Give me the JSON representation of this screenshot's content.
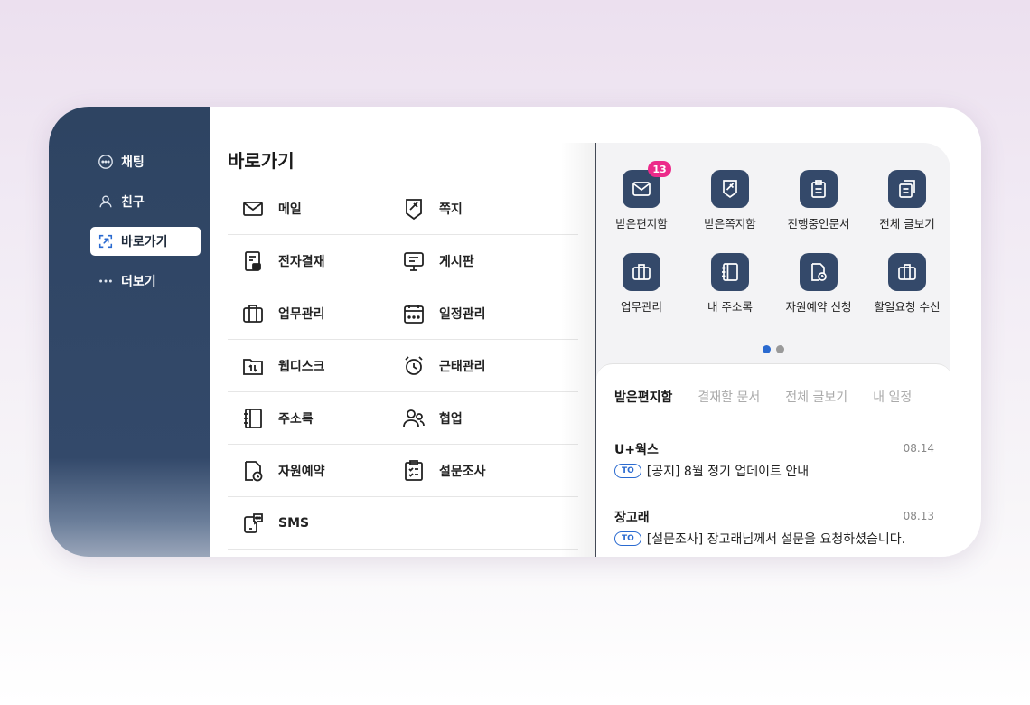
{
  "sidebar": {
    "items": [
      {
        "label": "채팅",
        "icon": "chat-icon"
      },
      {
        "label": "친구",
        "icon": "person-icon"
      },
      {
        "label": "바로가기",
        "icon": "shortcut-icon",
        "active": true
      },
      {
        "label": "더보기",
        "icon": "more-icon"
      }
    ]
  },
  "shortcuts": {
    "title": "바로가기",
    "items": [
      {
        "label": "메일",
        "icon": "mail-icon"
      },
      {
        "label": "쪽지",
        "icon": "note-icon"
      },
      {
        "label": "전자결재",
        "icon": "approval-icon"
      },
      {
        "label": "게시판",
        "icon": "board-icon"
      },
      {
        "label": "업무관리",
        "icon": "briefcase-icon"
      },
      {
        "label": "일정관리",
        "icon": "calendar-icon"
      },
      {
        "label": "웹디스크",
        "icon": "webdisk-icon"
      },
      {
        "label": "근태관리",
        "icon": "alarm-icon"
      },
      {
        "label": "주소록",
        "icon": "addressbook-icon"
      },
      {
        "label": "협업",
        "icon": "collab-icon"
      },
      {
        "label": "자원예약",
        "icon": "reservation-icon"
      },
      {
        "label": "설문조사",
        "icon": "survey-icon"
      },
      {
        "label": "SMS",
        "icon": "sms-icon"
      }
    ]
  },
  "widget": {
    "apps": [
      {
        "label": "받은편지함",
        "icon": "mail-icon",
        "badge": "13"
      },
      {
        "label": "받은쪽지함",
        "icon": "note-icon"
      },
      {
        "label": "진행중인문서",
        "icon": "clipboard-icon"
      },
      {
        "label": "전체 글보기",
        "icon": "documents-icon"
      },
      {
        "label": "업무관리",
        "icon": "briefcase-icon"
      },
      {
        "label": "내 주소록",
        "icon": "addressbook-icon"
      },
      {
        "label": "자원예약 신청",
        "icon": "reservation-icon"
      },
      {
        "label": "할일요청 수신",
        "icon": "briefcase-icon"
      }
    ],
    "page_dots": {
      "count": 2,
      "active": 1
    },
    "tabs": [
      "받은편지함",
      "결재할 문서",
      "전체 글보기",
      "내 일정"
    ],
    "active_tab": "받은편지함",
    "messages": [
      {
        "sender": "U+웍스",
        "date": "08.14",
        "to_label": "TO",
        "subject": "[공지] 8월 정기 업데이트 안내"
      },
      {
        "sender": "장고래",
        "date": "08.13",
        "to_label": "TO",
        "subject": "[설문조사] 장고래님께서 설문을 요청하셨습니다."
      }
    ]
  },
  "colors": {
    "sidebar": "#33496a",
    "accent_blue": "#2a6ad0",
    "badge_pink": "#ec2a8a",
    "app_icon_bg": "#34496a"
  }
}
